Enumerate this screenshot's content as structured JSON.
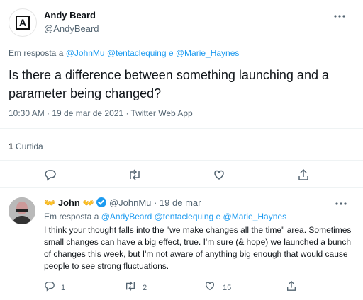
{
  "main_tweet": {
    "author_name": "Andy Beard",
    "author_handle": "@AndyBeard",
    "reply_prefix": "Em resposta a",
    "reply_mentions": "@JohnMu @tentaclequing e @Marie_Haynes",
    "text": "Is there a difference between something launching and a parameter being changed?",
    "timestamp": "10:30 AM · 19 de mar de 2021 · Twitter Web App",
    "like_count": "1",
    "like_label": "Curtida"
  },
  "reply_tweet": {
    "author_name": "John",
    "author_emoji_left": "👐",
    "author_emoji_right": "👐",
    "author_handle": "@JohnMu",
    "date": "· 19 de mar",
    "reply_prefix": "Em resposta a",
    "reply_mentions": "@AndyBeard @tentaclequing e @Marie_Haynes",
    "text": "I think your thought falls into the \"we make changes all the time\" area. Sometimes small changes can have a big effect, true. I'm sure (& hope) we launched a bunch of changes this week, but I'm not aware of anything big enough that would cause people to see strong fluctuations.",
    "reply_count": "1",
    "retweet_count": "2",
    "like_count": "15"
  },
  "colors": {
    "accent": "#1d9bf0",
    "muted": "#536471",
    "verified": "#1d9bf0"
  },
  "icons": [
    "more-icon",
    "reply-icon",
    "retweet-icon",
    "like-icon",
    "share-icon",
    "verified-icon"
  ]
}
